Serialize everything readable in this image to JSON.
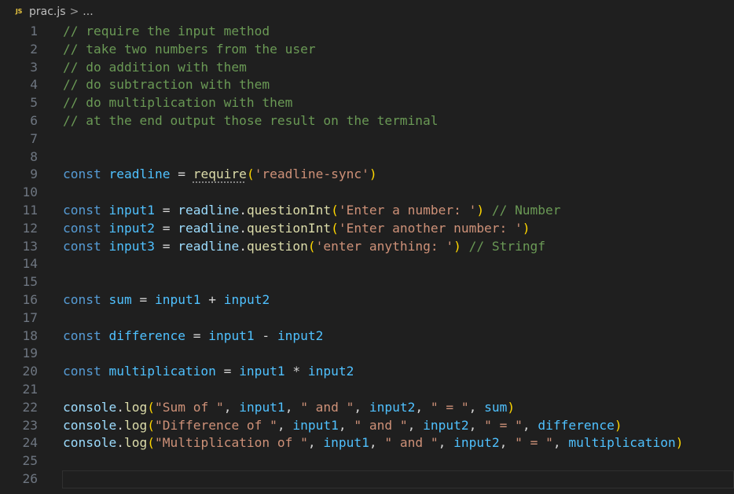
{
  "breadcrumb": {
    "icon": "js-file-icon",
    "icon_label": "JS",
    "file": "prac.js",
    "separator": ">",
    "rest": "..."
  },
  "editor": {
    "current_line": 26,
    "lines": [
      {
        "n": "1",
        "tokens": [
          {
            "t": "// require the input method",
            "c": "comment"
          }
        ]
      },
      {
        "n": "2",
        "tokens": [
          {
            "t": "// take two numbers from the user",
            "c": "comment"
          }
        ]
      },
      {
        "n": "3",
        "tokens": [
          {
            "t": "// do addition with them",
            "c": "comment"
          }
        ]
      },
      {
        "n": "4",
        "tokens": [
          {
            "t": "// do subtraction with them",
            "c": "comment"
          }
        ]
      },
      {
        "n": "5",
        "tokens": [
          {
            "t": "// do multiplication with them",
            "c": "comment"
          }
        ]
      },
      {
        "n": "6",
        "tokens": [
          {
            "t": "// at the end output those result on the terminal",
            "c": "comment"
          }
        ]
      },
      {
        "n": "7",
        "tokens": []
      },
      {
        "n": "8",
        "tokens": []
      },
      {
        "n": "9",
        "tokens": [
          {
            "t": "const",
            "c": "keyword"
          },
          {
            "t": " ",
            "c": "plain"
          },
          {
            "t": "readline",
            "c": "var"
          },
          {
            "t": " = ",
            "c": "op"
          },
          {
            "t": "require",
            "c": "func",
            "dotted": true
          },
          {
            "t": "(",
            "c": "paren"
          },
          {
            "t": "'readline-sync'",
            "c": "string"
          },
          {
            "t": ")",
            "c": "paren"
          }
        ]
      },
      {
        "n": "10",
        "tokens": []
      },
      {
        "n": "11",
        "tokens": [
          {
            "t": "const",
            "c": "keyword"
          },
          {
            "t": " ",
            "c": "plain"
          },
          {
            "t": "input1",
            "c": "var"
          },
          {
            "t": " = ",
            "c": "op"
          },
          {
            "t": "readline",
            "c": "obj"
          },
          {
            "t": ".",
            "c": "plain"
          },
          {
            "t": "questionInt",
            "c": "func"
          },
          {
            "t": "(",
            "c": "paren"
          },
          {
            "t": "'Enter a number: '",
            "c": "string"
          },
          {
            "t": ")",
            "c": "paren"
          },
          {
            "t": " ",
            "c": "plain"
          },
          {
            "t": "// Number",
            "c": "comment"
          }
        ]
      },
      {
        "n": "12",
        "tokens": [
          {
            "t": "const",
            "c": "keyword"
          },
          {
            "t": " ",
            "c": "plain"
          },
          {
            "t": "input2",
            "c": "var"
          },
          {
            "t": " = ",
            "c": "op"
          },
          {
            "t": "readline",
            "c": "obj"
          },
          {
            "t": ".",
            "c": "plain"
          },
          {
            "t": "questionInt",
            "c": "func"
          },
          {
            "t": "(",
            "c": "paren"
          },
          {
            "t": "'Enter another number: '",
            "c": "string"
          },
          {
            "t": ")",
            "c": "paren"
          }
        ]
      },
      {
        "n": "13",
        "tokens": [
          {
            "t": "const",
            "c": "keyword"
          },
          {
            "t": " ",
            "c": "plain"
          },
          {
            "t": "input3",
            "c": "var"
          },
          {
            "t": " = ",
            "c": "op"
          },
          {
            "t": "readline",
            "c": "obj"
          },
          {
            "t": ".",
            "c": "plain"
          },
          {
            "t": "question",
            "c": "func"
          },
          {
            "t": "(",
            "c": "paren"
          },
          {
            "t": "'enter anything: '",
            "c": "string"
          },
          {
            "t": ")",
            "c": "paren"
          },
          {
            "t": " ",
            "c": "plain"
          },
          {
            "t": "// Stringf",
            "c": "comment"
          }
        ]
      },
      {
        "n": "14",
        "tokens": []
      },
      {
        "n": "15",
        "tokens": []
      },
      {
        "n": "16",
        "tokens": [
          {
            "t": "const",
            "c": "keyword"
          },
          {
            "t": " ",
            "c": "plain"
          },
          {
            "t": "sum",
            "c": "var"
          },
          {
            "t": " = ",
            "c": "op"
          },
          {
            "t": "input1",
            "c": "var"
          },
          {
            "t": " + ",
            "c": "op"
          },
          {
            "t": "input2",
            "c": "var"
          }
        ]
      },
      {
        "n": "17",
        "tokens": []
      },
      {
        "n": "18",
        "tokens": [
          {
            "t": "const",
            "c": "keyword"
          },
          {
            "t": " ",
            "c": "plain"
          },
          {
            "t": "difference",
            "c": "var"
          },
          {
            "t": " = ",
            "c": "op"
          },
          {
            "t": "input1",
            "c": "var"
          },
          {
            "t": " - ",
            "c": "op"
          },
          {
            "t": "input2",
            "c": "var"
          }
        ]
      },
      {
        "n": "19",
        "tokens": []
      },
      {
        "n": "20",
        "tokens": [
          {
            "t": "const",
            "c": "keyword"
          },
          {
            "t": " ",
            "c": "plain"
          },
          {
            "t": "multiplication",
            "c": "var"
          },
          {
            "t": " = ",
            "c": "op"
          },
          {
            "t": "input1",
            "c": "var"
          },
          {
            "t": " * ",
            "c": "op"
          },
          {
            "t": "input2",
            "c": "var"
          }
        ]
      },
      {
        "n": "21",
        "tokens": []
      },
      {
        "n": "22",
        "tokens": [
          {
            "t": "console",
            "c": "obj"
          },
          {
            "t": ".",
            "c": "plain"
          },
          {
            "t": "log",
            "c": "func"
          },
          {
            "t": "(",
            "c": "paren"
          },
          {
            "t": "\"Sum of \"",
            "c": "string"
          },
          {
            "t": ", ",
            "c": "plain"
          },
          {
            "t": "input1",
            "c": "var"
          },
          {
            "t": ", ",
            "c": "plain"
          },
          {
            "t": "\" and \"",
            "c": "string"
          },
          {
            "t": ", ",
            "c": "plain"
          },
          {
            "t": "input2",
            "c": "var"
          },
          {
            "t": ", ",
            "c": "plain"
          },
          {
            "t": "\" = \"",
            "c": "string"
          },
          {
            "t": ", ",
            "c": "plain"
          },
          {
            "t": "sum",
            "c": "var"
          },
          {
            "t": ")",
            "c": "paren"
          }
        ]
      },
      {
        "n": "23",
        "tokens": [
          {
            "t": "console",
            "c": "obj"
          },
          {
            "t": ".",
            "c": "plain"
          },
          {
            "t": "log",
            "c": "func"
          },
          {
            "t": "(",
            "c": "paren"
          },
          {
            "t": "\"Difference of \"",
            "c": "string"
          },
          {
            "t": ", ",
            "c": "plain"
          },
          {
            "t": "input1",
            "c": "var"
          },
          {
            "t": ", ",
            "c": "plain"
          },
          {
            "t": "\" and \"",
            "c": "string"
          },
          {
            "t": ", ",
            "c": "plain"
          },
          {
            "t": "input2",
            "c": "var"
          },
          {
            "t": ", ",
            "c": "plain"
          },
          {
            "t": "\" = \"",
            "c": "string"
          },
          {
            "t": ", ",
            "c": "plain"
          },
          {
            "t": "difference",
            "c": "var"
          },
          {
            "t": ")",
            "c": "paren"
          }
        ]
      },
      {
        "n": "24",
        "tokens": [
          {
            "t": "console",
            "c": "obj"
          },
          {
            "t": ".",
            "c": "plain"
          },
          {
            "t": "log",
            "c": "func"
          },
          {
            "t": "(",
            "c": "paren"
          },
          {
            "t": "\"Multiplication of \"",
            "c": "string"
          },
          {
            "t": ", ",
            "c": "plain"
          },
          {
            "t": "input1",
            "c": "var"
          },
          {
            "t": ", ",
            "c": "plain"
          },
          {
            "t": "\" and \"",
            "c": "string"
          },
          {
            "t": ", ",
            "c": "plain"
          },
          {
            "t": "input2",
            "c": "var"
          },
          {
            "t": ", ",
            "c": "plain"
          },
          {
            "t": "\" = \"",
            "c": "string"
          },
          {
            "t": ", ",
            "c": "plain"
          },
          {
            "t": "multiplication",
            "c": "var"
          },
          {
            "t": ")",
            "c": "paren"
          }
        ]
      },
      {
        "n": "25",
        "tokens": []
      },
      {
        "n": "26",
        "tokens": []
      }
    ]
  },
  "colors": {
    "background": "#1f1f1f",
    "line_number": "#6e7681",
    "comment": "#6a9955",
    "keyword": "#569cd6",
    "variable": "#4fc1ff",
    "function": "#dcdcaa",
    "string": "#ce9178",
    "bracket": "#ffd700",
    "js_icon": "#e8c53f"
  }
}
